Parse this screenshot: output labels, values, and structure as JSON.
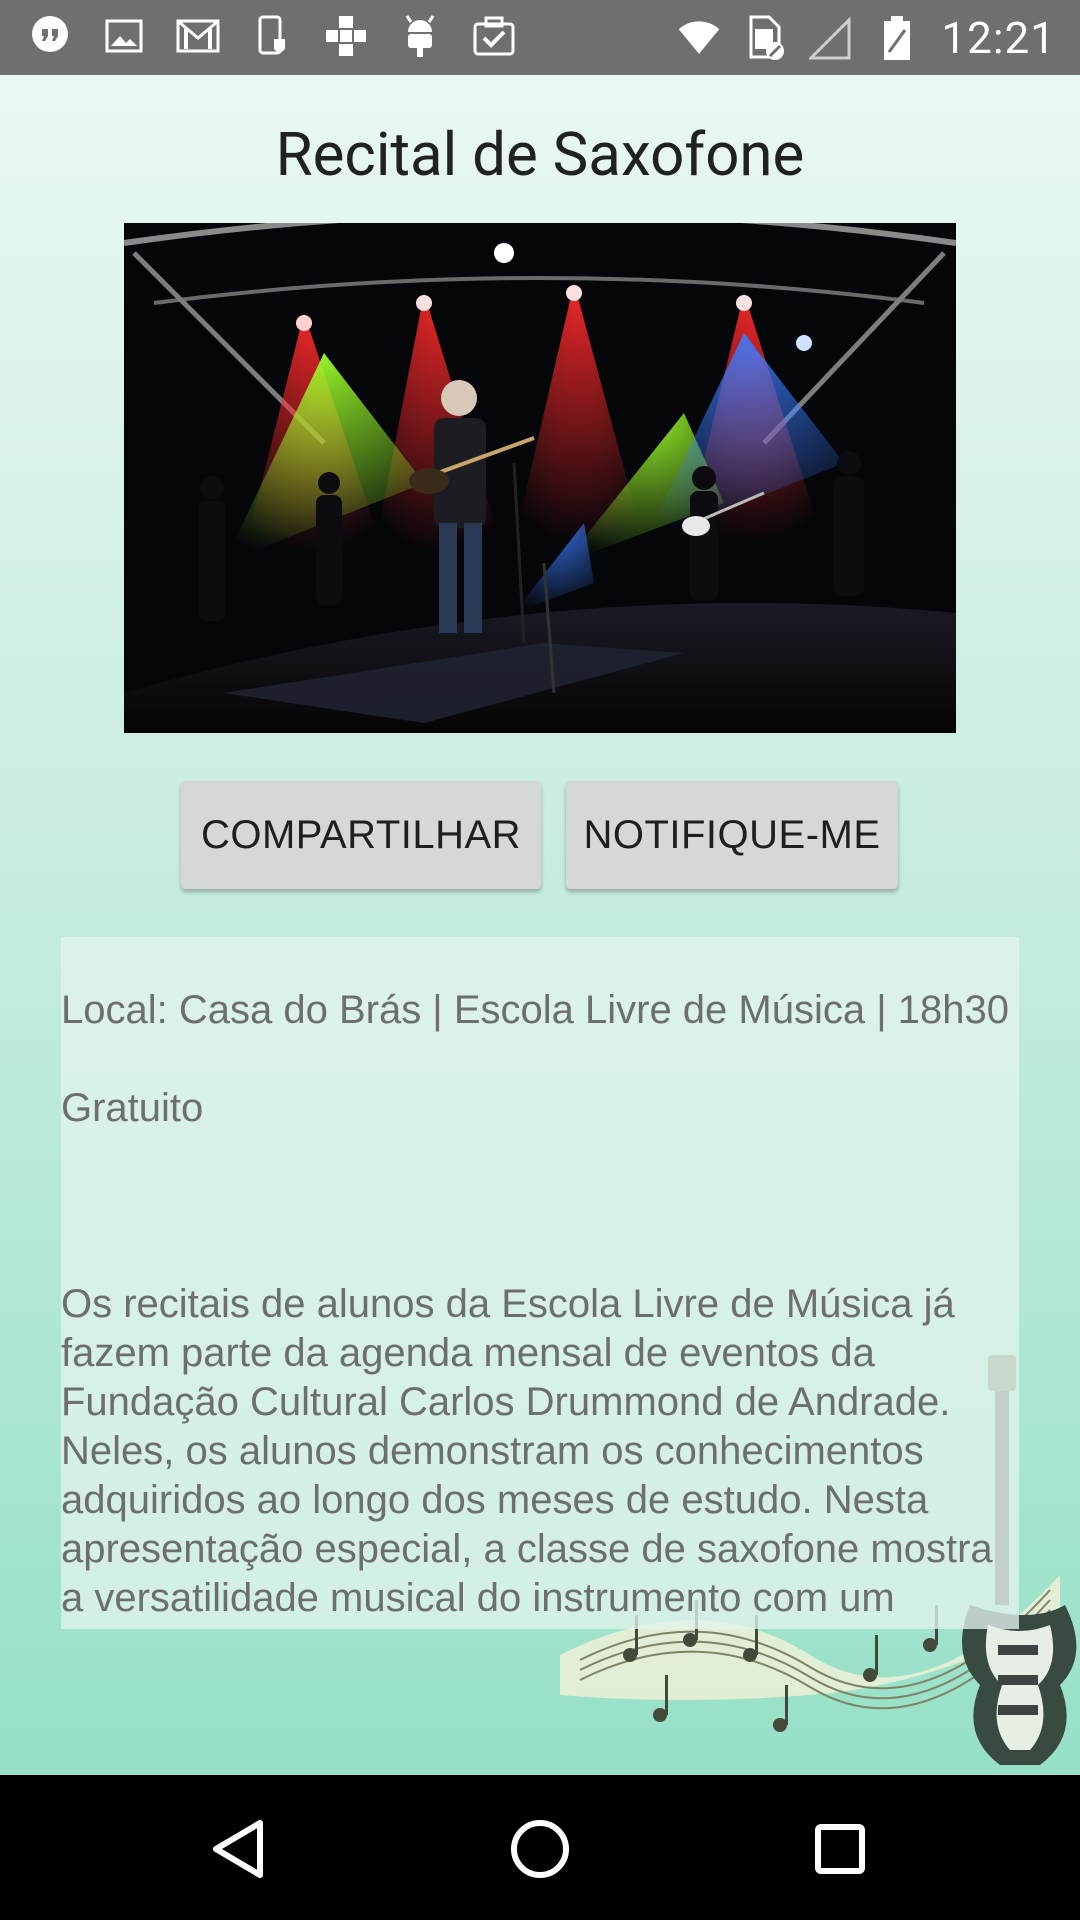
{
  "status_bar": {
    "time": "12:21",
    "left_icons": [
      "hangouts-icon",
      "gallery-icon",
      "gmail-icon",
      "device-icon",
      "plus-tiles-icon",
      "android-icon",
      "task-icon"
    ],
    "right_icons": [
      "wifi-icon",
      "sim-icon",
      "signal-icon",
      "battery-icon"
    ]
  },
  "event": {
    "title": "Recital de Saxofone",
    "image_alt": "Concert stage with colorful lights"
  },
  "actions": {
    "share_label": "COMPARTILHAR",
    "notify_label": "NOTIFIQUE-ME"
  },
  "details": {
    "location_line": "Local: Casa do Brás | Escola Livre de Música | 18h30",
    "price": "Gratuito",
    "description": "Os recitais de alunos da Escola Livre de Música já fazem parte da agenda mensal de eventos da Fundação Cultural Carlos Drummond de Andrade. Neles, os alunos demonstram os conhecimentos adquiridos ao longo dos meses de estudo. Nesta apresentação especial, a classe de saxofone mostra a versatilidade musical do instrumento com um repertório variado de canções de Charles Chaplin, Tom Jobim, Vinicius de Moraes e Chiquinha Gonzaga, entre outros."
  },
  "navigation": {
    "back": "back-icon",
    "home": "home-icon",
    "recents": "recents-icon"
  },
  "colors": {
    "status_bar": "#6f6f6f",
    "background_top": "#e9f8f3",
    "background_bottom": "#96e0c7",
    "button_bg": "#d6d7d7",
    "text": "#6e6e6e"
  }
}
